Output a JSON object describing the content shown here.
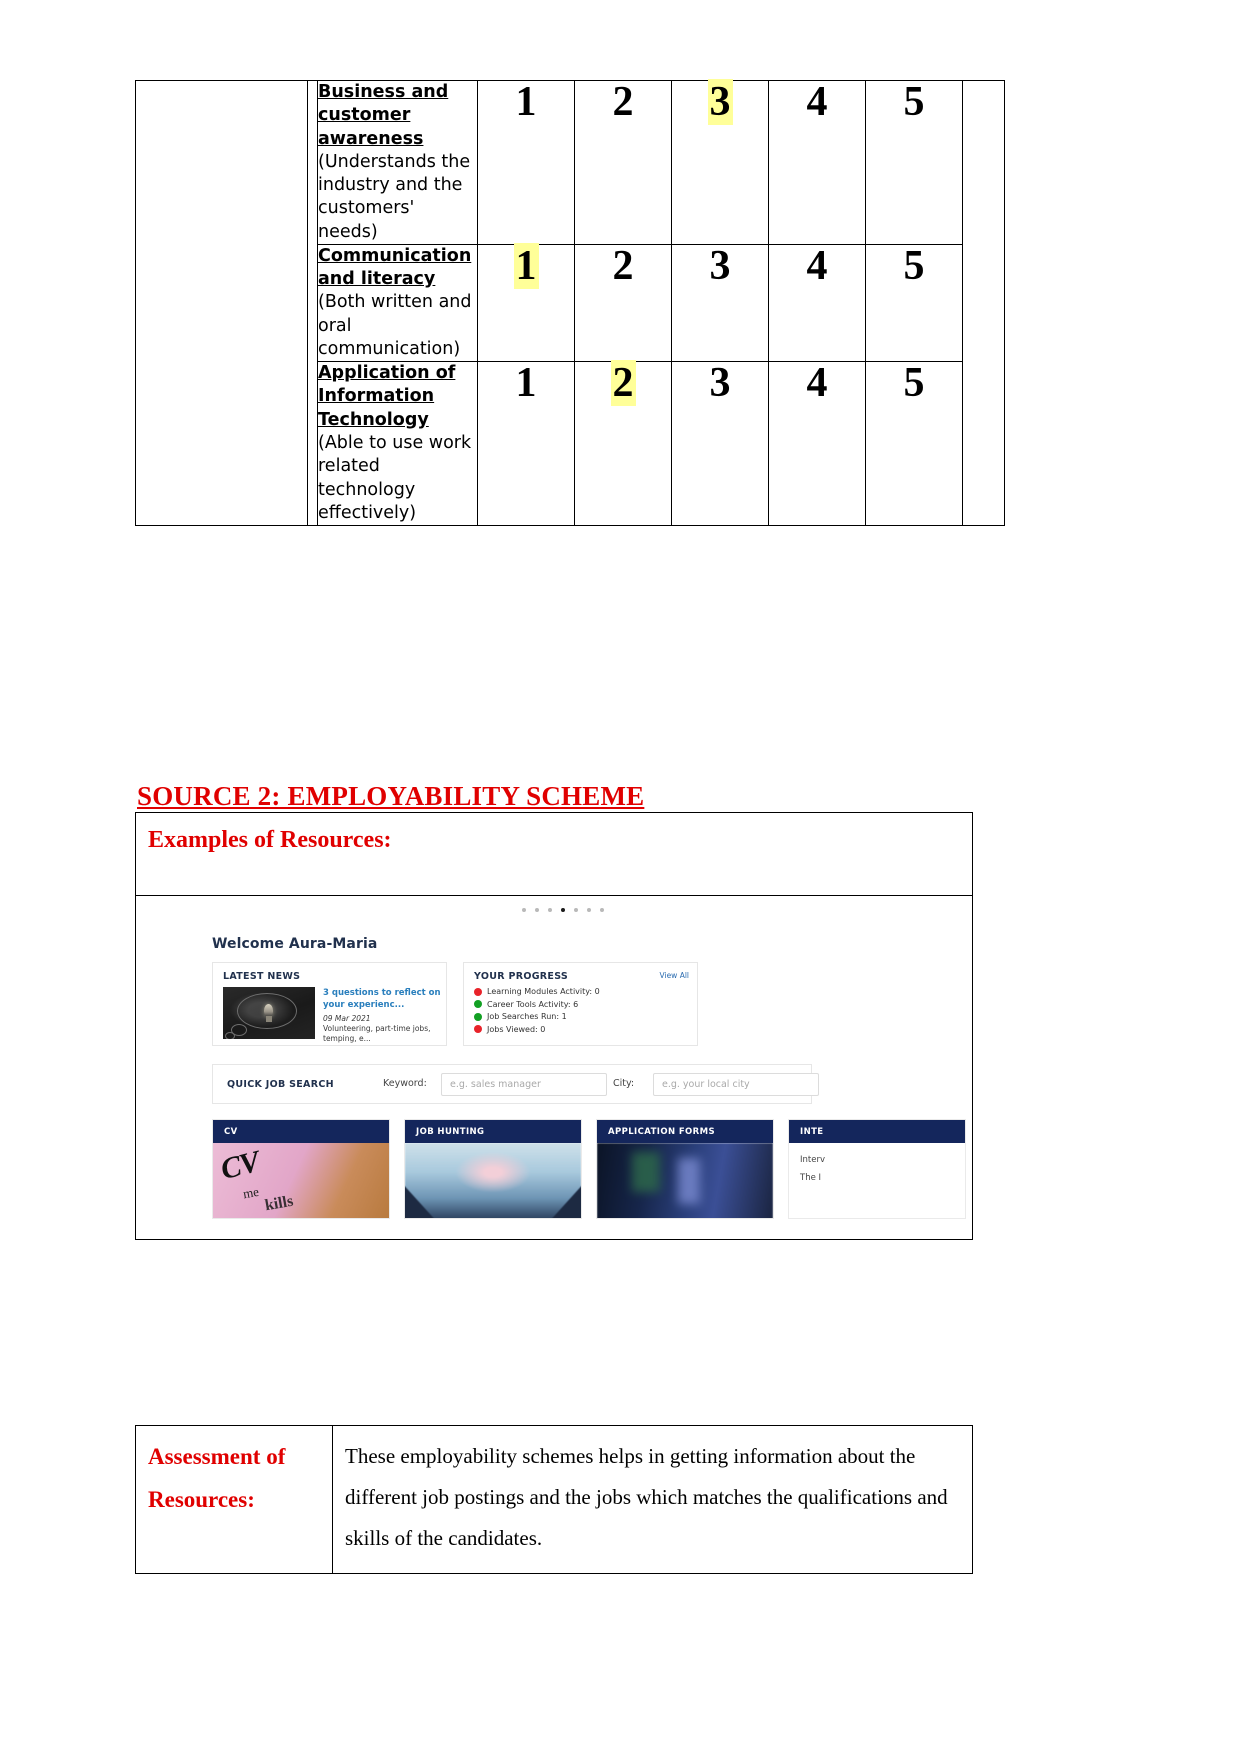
{
  "rating_table": {
    "scale_max": 5,
    "rows": [
      {
        "title": "Business and customer awareness",
        "subtitle": "(Understands the industry and the customers' needs)",
        "numbers": [
          "1",
          "2",
          "3",
          "4",
          "5"
        ],
        "selected": "3"
      },
      {
        "title": "Communication and literacy",
        "subtitle": "(Both written and oral communication)",
        "numbers": [
          "1",
          "2",
          "3",
          "4",
          "5"
        ],
        "selected": "1"
      },
      {
        "title": "Application of Information Technology",
        "subtitle": "(Able to use work related technology effectively)",
        "numbers": [
          "1",
          "2",
          "3",
          "4",
          "5"
        ],
        "selected": "2"
      }
    ],
    "highlight_color": "#ffff99"
  },
  "source_heading": "SOURCE 2: EMPLOYABILITY SCHEME",
  "resources_box": {
    "title": "Examples of Resources:",
    "title_color": "#e00000"
  },
  "dashboard": {
    "carousel": {
      "total_dots": 7,
      "active_index": 3
    },
    "welcome": "Welcome Aura-Maria",
    "latest_news": {
      "panel_title": "LATEST NEWS",
      "headline": "3 questions to reflect on your experienc...",
      "date": "09 Mar 2021",
      "description": "Volunteering, part-time jobs, temping, e..."
    },
    "your_progress": {
      "panel_title": "YOUR PROGRESS",
      "view_all": "View All",
      "items": [
        {
          "label": "Learning Modules Activity: 0",
          "status_color": "#e8232a"
        },
        {
          "label": "Career Tools Activity: 6",
          "status_color": "#12a023"
        },
        {
          "label": "Job Searches Run: 1",
          "status_color": "#12a023"
        },
        {
          "label": "Jobs Viewed: 0",
          "status_color": "#e8232a"
        }
      ]
    },
    "quick_job_search": {
      "title": "QUICK JOB SEARCH",
      "keyword_label": "Keyword:",
      "keyword_placeholder": "e.g. sales manager",
      "keyword_value": "",
      "city_label": "City:",
      "city_placeholder": "e.g. your local city",
      "city_value": ""
    },
    "tiles": [
      {
        "title": "CV",
        "cv_mark": "CV",
        "cv_sub": "me",
        "cv_sub2": "kills"
      },
      {
        "title": "JOB HUNTING"
      },
      {
        "title": "APPLICATION FORMS"
      },
      {
        "title": "INTE",
        "line1": "Interv",
        "line2": "The I"
      }
    ]
  },
  "assessment": {
    "label": "Assessment of Resources:",
    "body": "These employability schemes helps in getting information about the different job postings and the jobs which matches the qualifications and skills of the candidates."
  }
}
